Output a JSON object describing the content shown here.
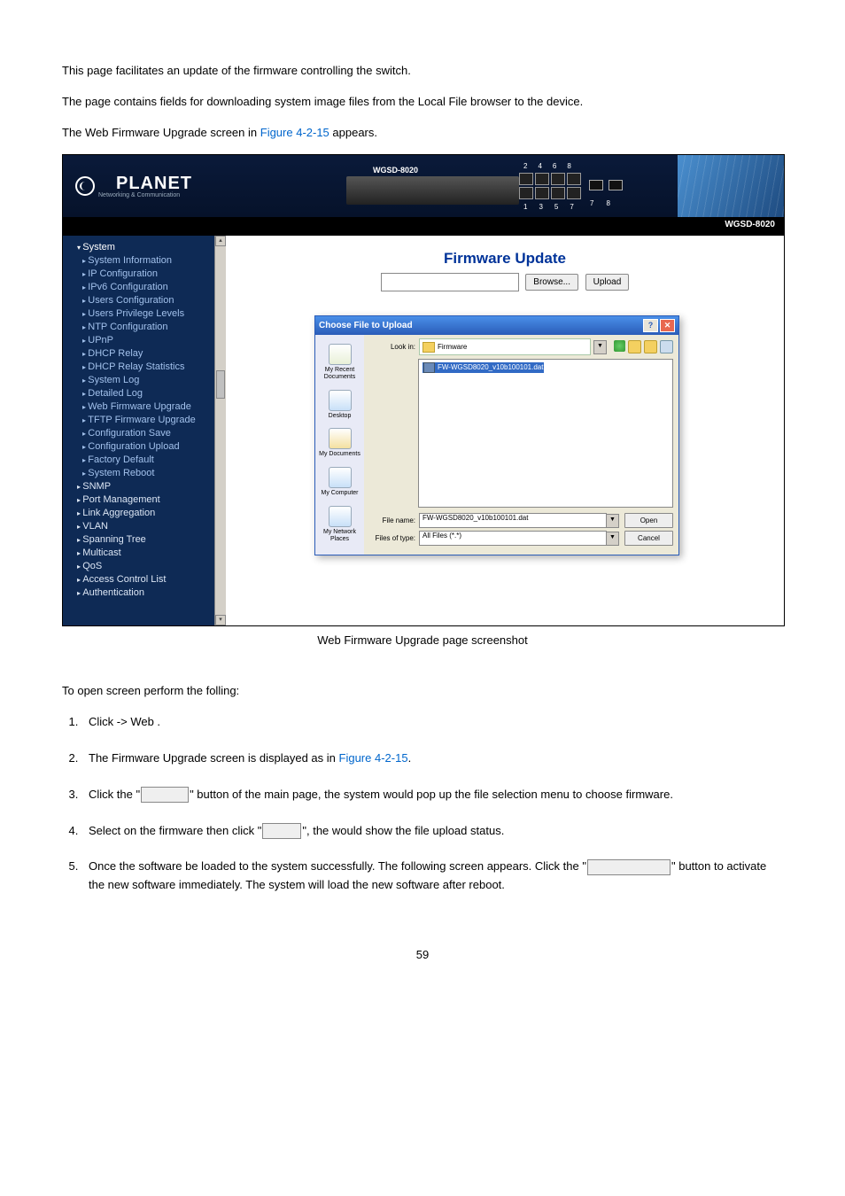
{
  "intro": {
    "p1": "This page facilitates an update of the firmware controlling the switch.",
    "p2a": "The ",
    "p2b": " page contains fields for downloading system image files from the Local File browser to the device.",
    "p3a": "The Web Firmware Upgrade screen in ",
    "p3b": " appears.",
    "figref": "Figure 4-2-15"
  },
  "screenshot": {
    "logo": "PLANET",
    "logo_sub": "Networking & Communication",
    "model_header": "WGSD-8020",
    "stripe": "WGSD-8020",
    "port_top": [
      "2",
      "4",
      "6",
      "8"
    ],
    "port_bot": [
      "1",
      "3",
      "5",
      "7"
    ],
    "gbic_idx": [
      "7",
      "8"
    ],
    "sidebar": [
      {
        "label": "System",
        "cls": "s-exp s-item"
      },
      {
        "label": "System Information",
        "cls": "s-sub s-item"
      },
      {
        "label": "IP Configuration",
        "cls": "s-sub s-item"
      },
      {
        "label": "IPv6 Configuration",
        "cls": "s-sub s-item"
      },
      {
        "label": "Users Configuration",
        "cls": "s-sub s-item"
      },
      {
        "label": "Users Privilege Levels",
        "cls": "s-sub s-item"
      },
      {
        "label": "NTP Configuration",
        "cls": "s-sub s-item"
      },
      {
        "label": "UPnP",
        "cls": "s-sub s-item"
      },
      {
        "label": "DHCP Relay",
        "cls": "s-sub s-item"
      },
      {
        "label": "DHCP Relay Statistics",
        "cls": "s-sub s-item"
      },
      {
        "label": "System Log",
        "cls": "s-sub s-item"
      },
      {
        "label": "Detailed Log",
        "cls": "s-sub s-item"
      },
      {
        "label": "Web Firmware Upgrade",
        "cls": "s-sub s-item"
      },
      {
        "label": "TFTP Firmware Upgrade",
        "cls": "s-sub s-item"
      },
      {
        "label": "Configuration Save",
        "cls": "s-sub s-item"
      },
      {
        "label": "Configuration Upload",
        "cls": "s-sub s-item"
      },
      {
        "label": "Factory Default",
        "cls": "s-sub s-item"
      },
      {
        "label": "System Reboot",
        "cls": "s-sub s-item"
      },
      {
        "label": "SNMP",
        "cls": "s-col s-item"
      },
      {
        "label": "Port Management",
        "cls": "s-col s-item"
      },
      {
        "label": "Link Aggregation",
        "cls": "s-col s-item"
      },
      {
        "label": "VLAN",
        "cls": "s-col s-item"
      },
      {
        "label": "Spanning Tree",
        "cls": "s-col s-item"
      },
      {
        "label": "Multicast",
        "cls": "s-col s-item"
      },
      {
        "label": "QoS",
        "cls": "s-col s-item"
      },
      {
        "label": "Access Control List",
        "cls": "s-col s-item"
      },
      {
        "label": "Authentication",
        "cls": "s-col s-item"
      }
    ],
    "main": {
      "title": "Firmware Update",
      "browse": "Browse...",
      "upload": "Upload"
    },
    "dialog": {
      "title": "Choose File to Upload",
      "lookin_label": "Look in:",
      "lookin_value": "Firmware",
      "file_item": "FW-WGSD8020_v10b100101.dat",
      "places": [
        "My Recent Documents",
        "Desktop",
        "My Documents",
        "My Computer",
        "My Network Places"
      ],
      "filename_label": "File name:",
      "filename_value": "FW-WGSD8020_v10b100101.dat",
      "filetype_label": "Files of type:",
      "filetype_value": "All Files (*.*)",
      "open": "Open",
      "cancel": "Cancel"
    }
  },
  "caption": " Web Firmware Upgrade page screenshot",
  "steps": {
    "intro_a": "To open ",
    "intro_b": " screen perform the folling:",
    "s1a": "Click ",
    "s1b": " -> Web ",
    "s1c": ".",
    "s2a": "The Firmware Upgrade screen is displayed as in ",
    "s2b": ".",
    "s2ref": "Figure 4-2-15",
    "s3a": "Click the \"",
    "s3b": "\" button of the main page, the system would pop up the file selection menu to choose firmware.",
    "s4a": "Select on the firmware then click \"",
    "s4b": "\", the ",
    "s4c": " would show the file upload status.",
    "s5a": "Once the software be loaded to the system successfully. The following screen appears. Click the \"",
    "s5b": "\" button to activate the new software immediately. The system will load the new software after reboot."
  },
  "pagenum": "59"
}
